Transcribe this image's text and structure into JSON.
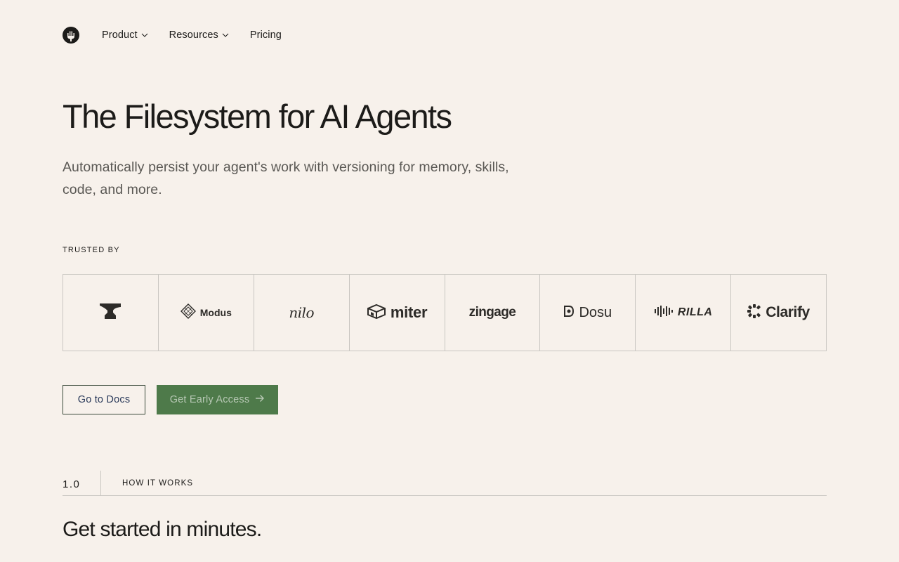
{
  "nav": {
    "items": [
      {
        "label": "Product",
        "has_dropdown": true
      },
      {
        "label": "Resources",
        "has_dropdown": true
      },
      {
        "label": "Pricing",
        "has_dropdown": false
      }
    ]
  },
  "hero": {
    "title": "The Filesystem for AI Agents",
    "subtitle": "Automatically persist your agent's work with versioning for memory, skills, code, and more."
  },
  "trusted": {
    "label": "TRUSTED BY",
    "logos": [
      {
        "name": "",
        "icon": "anvil-icon"
      },
      {
        "name": "Modus",
        "icon": "diamond-icon"
      },
      {
        "name": "nilo",
        "icon": ""
      },
      {
        "name": "miter",
        "icon": "cube-icon"
      },
      {
        "name": "zingage",
        "icon": ""
      },
      {
        "name": "Dosu",
        "icon": "dosu-icon"
      },
      {
        "name": "RILLA",
        "icon": "waveform-icon"
      },
      {
        "name": "Clarify",
        "icon": "clarify-icon"
      }
    ]
  },
  "buttons": {
    "docs": "Go to Docs",
    "access": "Get Early Access"
  },
  "section": {
    "number": "1.0",
    "label": "HOW IT WORKS",
    "title": "Get started in minutes."
  },
  "colors": {
    "background": "#f7f1eb",
    "text": "#1c1b19",
    "accent_green": "#4e7a4a",
    "border": "#c9c6c1"
  }
}
